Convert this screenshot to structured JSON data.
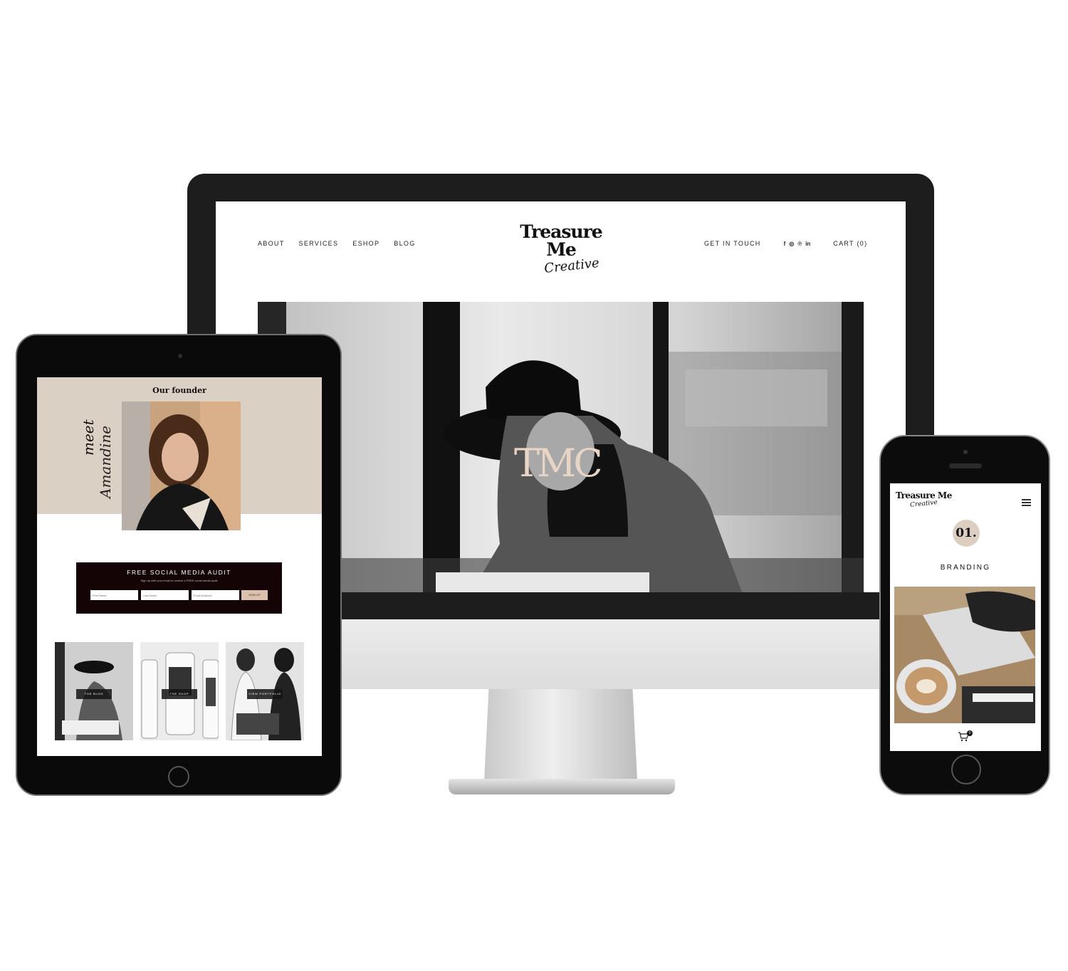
{
  "desktop": {
    "nav": {
      "about": "ABOUT",
      "services": "SERVICES",
      "eshop": "ESHOP",
      "blog": "BLOG",
      "get_in_touch": "GET IN TOUCH",
      "cart": "CART (0)"
    },
    "social_icons": [
      "facebook-icon",
      "instagram-icon",
      "pinterest-icon",
      "linkedin-icon"
    ],
    "social_glyphs": {
      "facebook": "f",
      "instagram": "◎",
      "pinterest": "℗",
      "linkedin": "in"
    },
    "logo": {
      "main": "Treasure Me",
      "script": "Creative"
    },
    "hero": {
      "monogram": "TMC",
      "monogram_color": "#e8d5c5"
    }
  },
  "tablet": {
    "founder_title": "Our founder",
    "founder_script_1": "meet",
    "founder_script_2": "Amandine",
    "band_color": "#dbd0c4",
    "audit": {
      "title": "FREE SOCIAL MEDIA AUDIT",
      "subtitle": "Sign up with your email to receive a FREE social media audit",
      "first_name_placeholder": "First Name",
      "last_name_placeholder": "Last Name",
      "email_placeholder": "Email Address",
      "button": "SIGN UP",
      "bg_color": "#140406",
      "button_color": "#dbc0ad"
    },
    "tiles": [
      {
        "label": "THE BLOG"
      },
      {
        "label": "THE SHOP"
      },
      {
        "label": "VIEW PORTFOLIO"
      }
    ]
  },
  "phone": {
    "logo": {
      "main": "Treasure Me",
      "script": "Creative"
    },
    "step_number": "01.",
    "heading": "BRANDING",
    "cart_count": "0",
    "badge_color": "#dccfc2"
  }
}
